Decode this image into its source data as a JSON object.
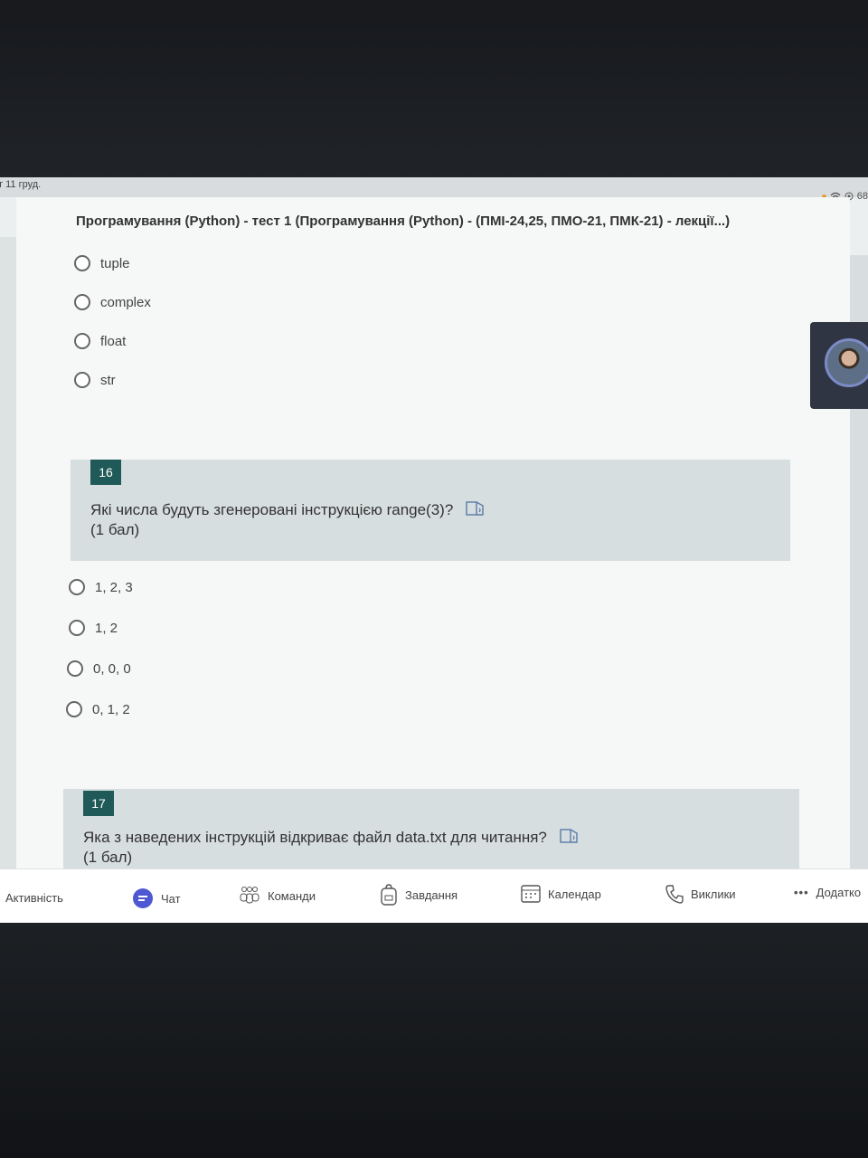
{
  "statusbar": {
    "date": "т 11 груд.",
    "battery": "68"
  },
  "document": {
    "title": "Програмування (Python) - тест 1 (Програмування (Python) - (ПМІ-24,25, ПМО-21, ПМК-21) - лекції...)"
  },
  "q15_options": [
    "tuple",
    "complex",
    "float",
    "str"
  ],
  "q16": {
    "number": "16",
    "text": "Які числа будуть згенеровані інструкцією range(3)?",
    "points": "(1 бал)",
    "options": [
      "1, 2, 3",
      "1, 2",
      "0, 0, 0",
      "0, 1, 2"
    ]
  },
  "q17": {
    "number": "17",
    "text": "Яка з наведених інструкцій відкриває файл data.txt для читання?",
    "points": "(1 бал)"
  },
  "taskbar": {
    "activity": "Активність",
    "chat": "Чат",
    "teams": "Команди",
    "assignments": "Завдання",
    "calendar": "Календар",
    "calls": "Виклики",
    "more": "Додатко"
  },
  "icons": {
    "chat": "chat-bubble-icon",
    "teams": "teams-icon",
    "assignments": "backpack-icon",
    "calendar": "calendar-icon",
    "calls": "phone-icon",
    "more": "ellipsis-icon",
    "speaker": "immersive-reader-icon"
  },
  "colors": {
    "accent": "#205a58",
    "chat_icon": "#4f58d3"
  }
}
